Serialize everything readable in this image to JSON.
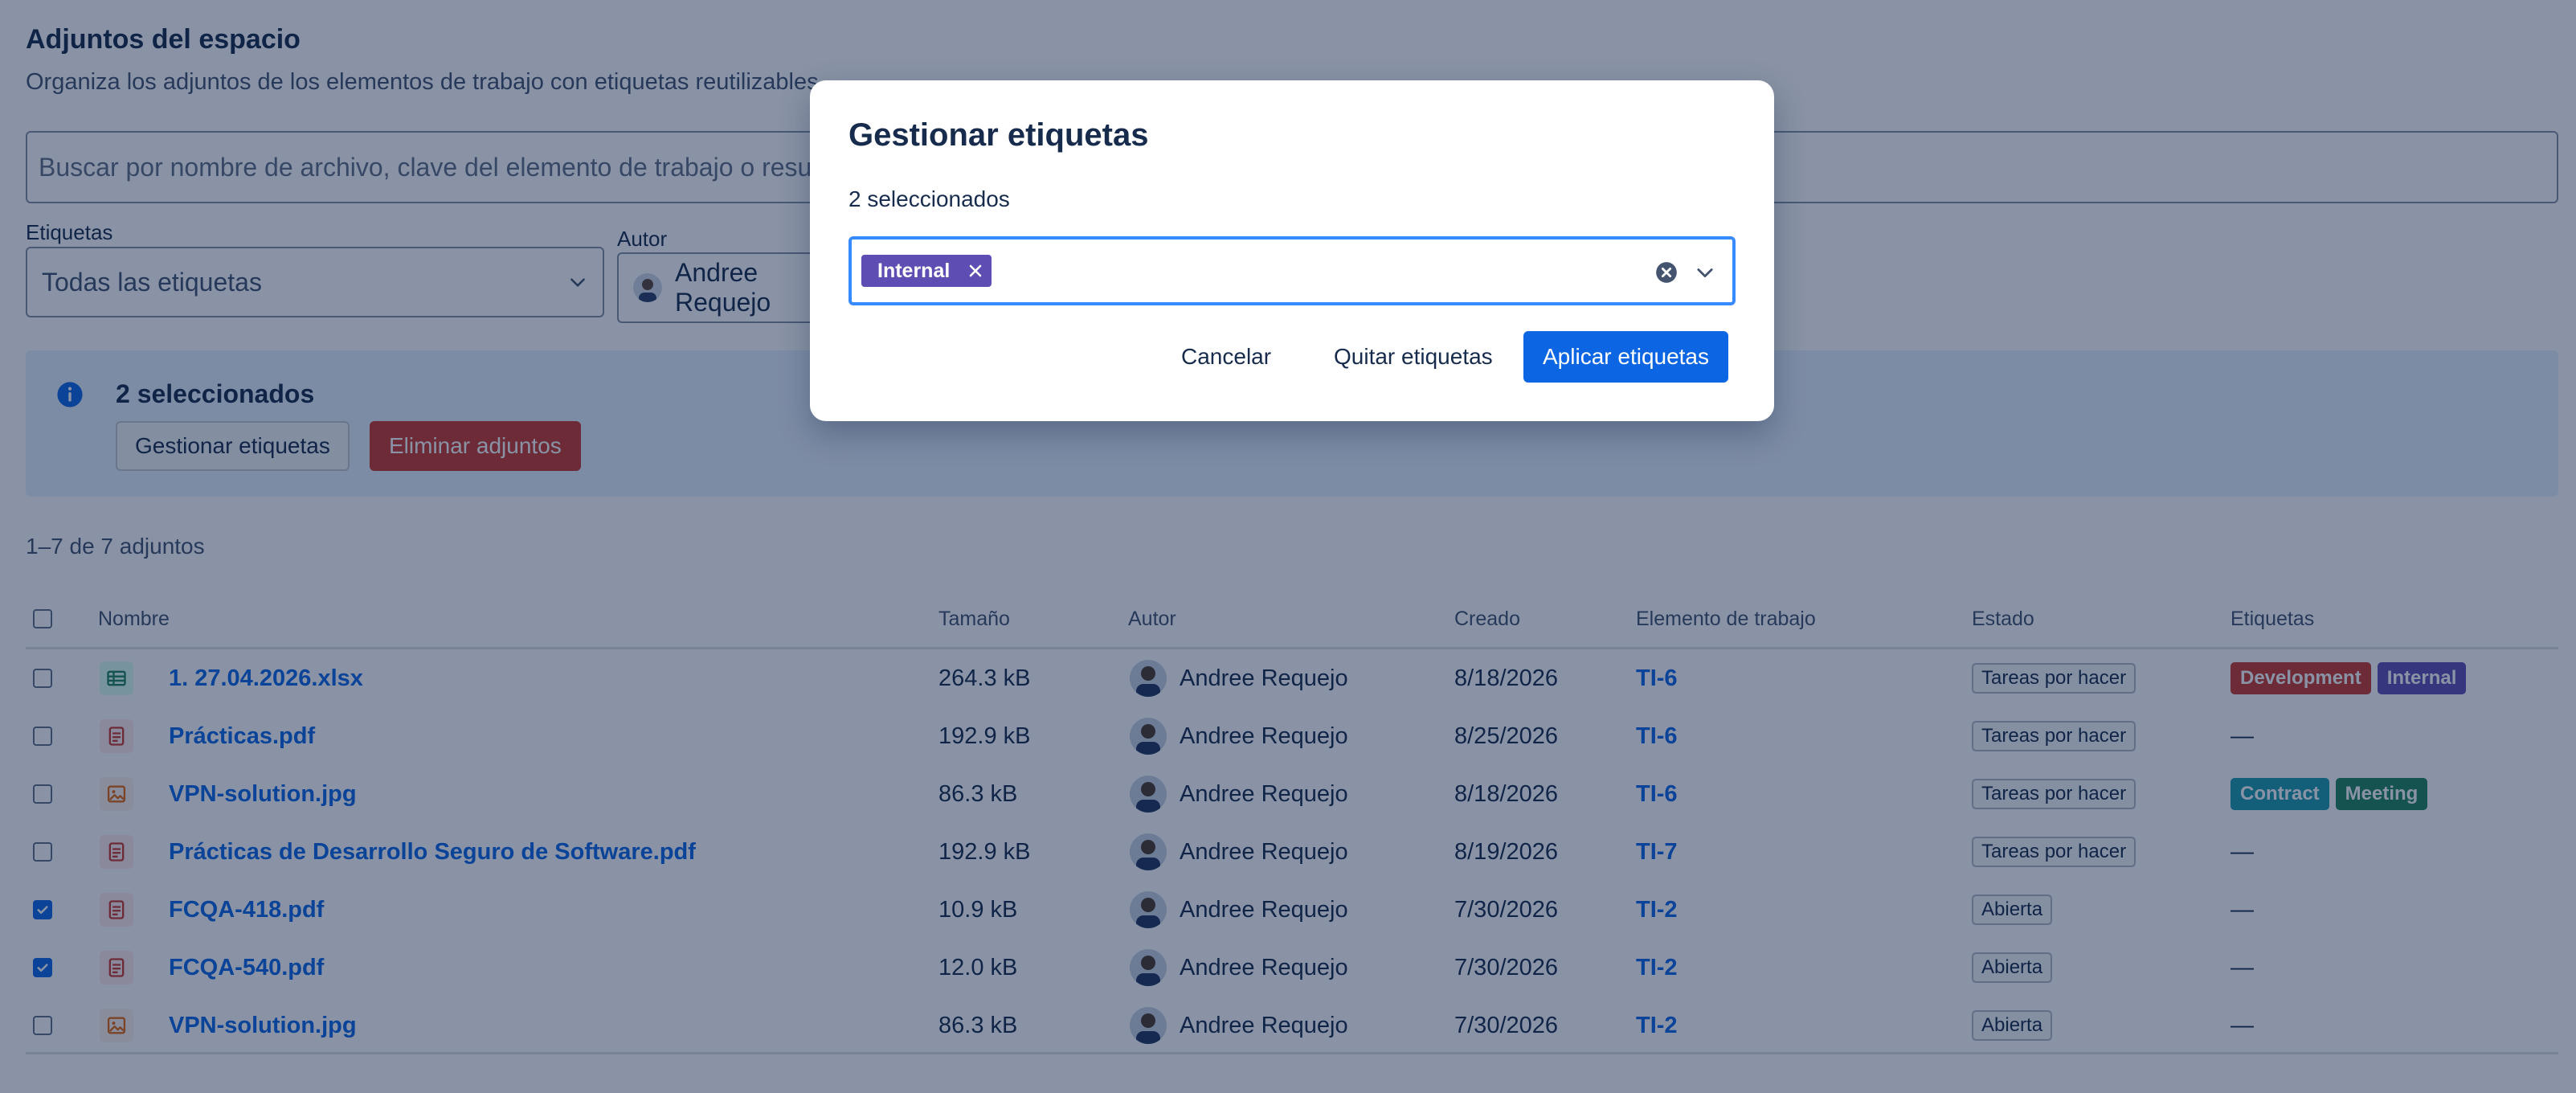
{
  "page": {
    "title": "Adjuntos del espacio",
    "subtitle": "Organiza los adjuntos de los elementos de trabajo con etiquetas reutilizables."
  },
  "search": {
    "placeholder": "Buscar por nombre de archivo, clave del elemento de trabajo o resumen"
  },
  "filters": {
    "labels_label": "Etiquetas",
    "labels_value": "Todas las etiquetas",
    "author_label": "Autor",
    "author_value": "Andree Requejo"
  },
  "banner": {
    "title": "2 seleccionados",
    "manage_button": "Gestionar etiquetas",
    "delete_button": "Eliminar adjuntos"
  },
  "results_count": "1–7 de 7 adjuntos",
  "table": {
    "headers": {
      "name": "Nombre",
      "size": "Tamaño",
      "author": "Autor",
      "created": "Creado",
      "work_item": "Elemento de trabajo",
      "status": "Estado",
      "labels": "Etiquetas"
    },
    "rows": [
      {
        "checked": false,
        "file_type": "spreadsheet-icon",
        "name": "1. 27.04.2026.xlsx",
        "size": "264.3 kB",
        "author": "Andree Requejo",
        "created": "8/18/2026",
        "work_item": "TI-6",
        "status": "Tareas por hacer",
        "labels": [
          {
            "text": "Development",
            "color": "#c9372c"
          },
          {
            "text": "Internal",
            "color": "#5e4db2"
          }
        ],
        "empty_labels": ""
      },
      {
        "checked": false,
        "file_type": "document-icon",
        "name": "Prácticas.pdf",
        "size": "192.9 kB",
        "author": "Andree Requejo",
        "created": "8/25/2026",
        "work_item": "TI-6",
        "status": "Tareas por hacer",
        "labels": [],
        "empty_labels": "—"
      },
      {
        "checked": false,
        "file_type": "image-icon",
        "name": "VPN-solution.jpg",
        "size": "86.3 kB",
        "author": "Andree Requejo",
        "created": "8/18/2026",
        "work_item": "TI-6",
        "status": "Tareas por hacer",
        "labels": [
          {
            "text": "Contract",
            "color": "#1d9aaa"
          },
          {
            "text": "Meeting",
            "color": "#1f845a"
          }
        ],
        "empty_labels": ""
      },
      {
        "checked": false,
        "file_type": "document-icon",
        "name": "Prácticas de Desarrollo Seguro de Software.pdf",
        "size": "192.9 kB",
        "author": "Andree Requejo",
        "created": "8/19/2026",
        "work_item": "TI-7",
        "status": "Tareas por hacer",
        "labels": [],
        "empty_labels": "—"
      },
      {
        "checked": true,
        "file_type": "document-icon",
        "name": "FCQA-418.pdf",
        "size": "10.9 kB",
        "author": "Andree Requejo",
        "created": "7/30/2026",
        "work_item": "TI-2",
        "status": "Abierta",
        "labels": [],
        "empty_labels": "—"
      },
      {
        "checked": true,
        "file_type": "document-icon",
        "name": "FCQA-540.pdf",
        "size": "12.0 kB",
        "author": "Andree Requejo",
        "created": "7/30/2026",
        "work_item": "TI-2",
        "status": "Abierta",
        "labels": [],
        "empty_labels": "—"
      },
      {
        "checked": false,
        "file_type": "image-icon",
        "name": "VPN-solution.jpg",
        "size": "86.3 kB",
        "author": "Andree Requejo",
        "created": "7/30/2026",
        "work_item": "TI-2",
        "status": "Abierta",
        "labels": [],
        "empty_labels": "—"
      }
    ]
  },
  "modal": {
    "title": "Gestionar etiquetas",
    "selected_count": "2 seleccionados",
    "selected_tags": [
      {
        "text": "Internal",
        "color": "#5e4db2"
      }
    ],
    "cancel_button": "Cancelar",
    "remove_button": "Quitar etiquetas",
    "apply_button": "Aplicar etiquetas"
  },
  "colors": {
    "accent": "#0c66e4",
    "danger": "#c9372c",
    "spreadsheet": "#1f845a",
    "document": "#c9372c",
    "image": "#e56910"
  }
}
